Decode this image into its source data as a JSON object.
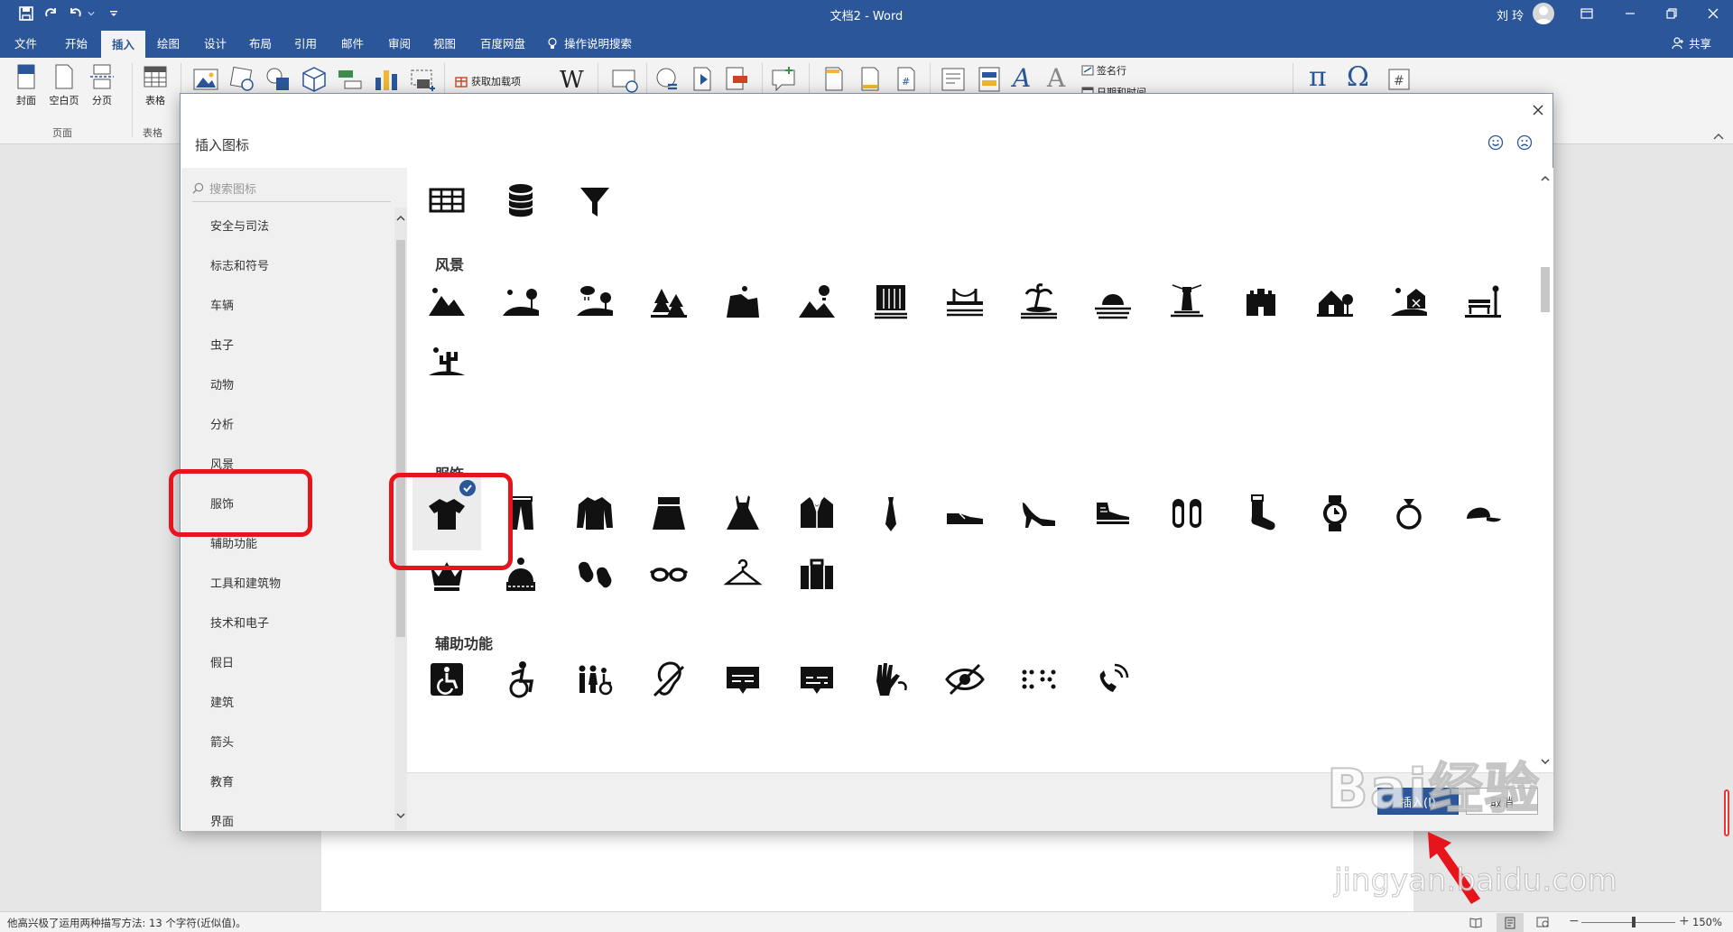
{
  "app": {
    "doc_title": "文档2 - Word",
    "user_name": "刘 玲",
    "share_label": "共享"
  },
  "tabs": [
    {
      "label": "文件"
    },
    {
      "label": "开始"
    },
    {
      "label": "插入",
      "active": true
    },
    {
      "label": "绘图"
    },
    {
      "label": "设计"
    },
    {
      "label": "布局"
    },
    {
      "label": "引用"
    },
    {
      "label": "邮件"
    },
    {
      "label": "审阅"
    },
    {
      "label": "视图"
    },
    {
      "label": "百度网盘"
    }
  ],
  "tell_me": "操作说明搜索",
  "ribbon": {
    "pages_buttons": [
      "封面",
      "空白页",
      "分页"
    ],
    "pages_group": "页面",
    "table_button": "表格",
    "table_group": "表格",
    "addins_label": "获取加载项",
    "signature_label": "签名行",
    "datetime_label": "日期和时间"
  },
  "dialog": {
    "title": "插入图标",
    "search_placeholder": "搜索图标",
    "categories": [
      "安全与司法",
      "标志和符号",
      "车辆",
      "虫子",
      "动物",
      "分析",
      "风景",
      "服饰",
      "辅助功能",
      "工具和建筑物",
      "技术和电子",
      "假日",
      "建筑",
      "箭头",
      "教育",
      "界面"
    ],
    "sections": [
      {
        "title": "风景",
        "icons": [
          "mountains-icon",
          "hills-tree-icon",
          "rain-landscape-icon",
          "pine-trees-icon",
          "cliff-icon",
          "hot-air-balloon-icon",
          "waterfall-icon",
          "bridge-icon",
          "island-palm-icon",
          "sunset-icon",
          "lighthouse-icon",
          "castle-icon",
          "farmhouse-icon",
          "barn-icon",
          "park-bench-icon",
          "desert-cactus-icon"
        ]
      },
      {
        "title": "服饰",
        "icons": [
          "tshirt-icon",
          "pants-icon",
          "sweater-icon",
          "skirt-icon",
          "dress-icon",
          "suit-jacket-icon",
          "tie-icon",
          "shoe-icon",
          "high-heel-icon",
          "sneaker-icon",
          "slippers-icon",
          "sock-icon",
          "watch-icon",
          "ring-icon",
          "cap-icon",
          "crown-icon",
          "beanie-icon",
          "mittens-icon",
          "glasses-icon",
          "hanger-icon",
          "briefcase-icon"
        ]
      },
      {
        "title": "辅助功能",
        "icons": [
          "wheelchair-sign-icon",
          "active-wheelchair-icon",
          "family-accessible-icon",
          "hearing-impaired-icon",
          "closed-caption-icon",
          "subtitles-icon",
          "sign-language-icon",
          "low-vision-icon",
          "braille-icon",
          "volume-control-phone-icon"
        ]
      }
    ],
    "selected_icon": "tshirt-icon",
    "insert_label": "插入(I)",
    "cancel_label": "取消"
  },
  "status": {
    "text": "他高兴极了运用两种描写方法: 13 个字符(近似值)。",
    "zoom": "150%"
  },
  "watermark": {
    "logo": "Bai经验",
    "url": "jingyan.baidu.com"
  }
}
